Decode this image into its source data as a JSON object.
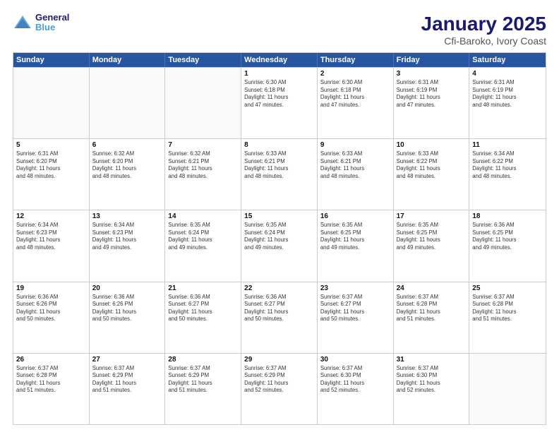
{
  "header": {
    "logo_line1": "General",
    "logo_line2": "Blue",
    "title": "January 2025",
    "subtitle": "Cfi-Baroko, Ivory Coast"
  },
  "days_of_week": [
    "Sunday",
    "Monday",
    "Tuesday",
    "Wednesday",
    "Thursday",
    "Friday",
    "Saturday"
  ],
  "weeks": [
    [
      {
        "num": "",
        "info": "",
        "empty": true
      },
      {
        "num": "",
        "info": "",
        "empty": true
      },
      {
        "num": "",
        "info": "",
        "empty": true
      },
      {
        "num": "1",
        "info": "Sunrise: 6:30 AM\nSunset: 6:18 PM\nDaylight: 11 hours\nand 47 minutes.",
        "empty": false
      },
      {
        "num": "2",
        "info": "Sunrise: 6:30 AM\nSunset: 6:18 PM\nDaylight: 11 hours\nand 47 minutes.",
        "empty": false
      },
      {
        "num": "3",
        "info": "Sunrise: 6:31 AM\nSunset: 6:19 PM\nDaylight: 11 hours\nand 47 minutes.",
        "empty": false
      },
      {
        "num": "4",
        "info": "Sunrise: 6:31 AM\nSunset: 6:19 PM\nDaylight: 11 hours\nand 48 minutes.",
        "empty": false
      }
    ],
    [
      {
        "num": "5",
        "info": "Sunrise: 6:31 AM\nSunset: 6:20 PM\nDaylight: 11 hours\nand 48 minutes.",
        "empty": false
      },
      {
        "num": "6",
        "info": "Sunrise: 6:32 AM\nSunset: 6:20 PM\nDaylight: 11 hours\nand 48 minutes.",
        "empty": false
      },
      {
        "num": "7",
        "info": "Sunrise: 6:32 AM\nSunset: 6:21 PM\nDaylight: 11 hours\nand 48 minutes.",
        "empty": false
      },
      {
        "num": "8",
        "info": "Sunrise: 6:33 AM\nSunset: 6:21 PM\nDaylight: 11 hours\nand 48 minutes.",
        "empty": false
      },
      {
        "num": "9",
        "info": "Sunrise: 6:33 AM\nSunset: 6:21 PM\nDaylight: 11 hours\nand 48 minutes.",
        "empty": false
      },
      {
        "num": "10",
        "info": "Sunrise: 6:33 AM\nSunset: 6:22 PM\nDaylight: 11 hours\nand 48 minutes.",
        "empty": false
      },
      {
        "num": "11",
        "info": "Sunrise: 6:34 AM\nSunset: 6:22 PM\nDaylight: 11 hours\nand 48 minutes.",
        "empty": false
      }
    ],
    [
      {
        "num": "12",
        "info": "Sunrise: 6:34 AM\nSunset: 6:23 PM\nDaylight: 11 hours\nand 48 minutes.",
        "empty": false
      },
      {
        "num": "13",
        "info": "Sunrise: 6:34 AM\nSunset: 6:23 PM\nDaylight: 11 hours\nand 49 minutes.",
        "empty": false
      },
      {
        "num": "14",
        "info": "Sunrise: 6:35 AM\nSunset: 6:24 PM\nDaylight: 11 hours\nand 49 minutes.",
        "empty": false
      },
      {
        "num": "15",
        "info": "Sunrise: 6:35 AM\nSunset: 6:24 PM\nDaylight: 11 hours\nand 49 minutes.",
        "empty": false
      },
      {
        "num": "16",
        "info": "Sunrise: 6:35 AM\nSunset: 6:25 PM\nDaylight: 11 hours\nand 49 minutes.",
        "empty": false
      },
      {
        "num": "17",
        "info": "Sunrise: 6:35 AM\nSunset: 6:25 PM\nDaylight: 11 hours\nand 49 minutes.",
        "empty": false
      },
      {
        "num": "18",
        "info": "Sunrise: 6:36 AM\nSunset: 6:25 PM\nDaylight: 11 hours\nand 49 minutes.",
        "empty": false
      }
    ],
    [
      {
        "num": "19",
        "info": "Sunrise: 6:36 AM\nSunset: 6:26 PM\nDaylight: 11 hours\nand 50 minutes.",
        "empty": false
      },
      {
        "num": "20",
        "info": "Sunrise: 6:36 AM\nSunset: 6:26 PM\nDaylight: 11 hours\nand 50 minutes.",
        "empty": false
      },
      {
        "num": "21",
        "info": "Sunrise: 6:36 AM\nSunset: 6:27 PM\nDaylight: 11 hours\nand 50 minutes.",
        "empty": false
      },
      {
        "num": "22",
        "info": "Sunrise: 6:36 AM\nSunset: 6:27 PM\nDaylight: 11 hours\nand 50 minutes.",
        "empty": false
      },
      {
        "num": "23",
        "info": "Sunrise: 6:37 AM\nSunset: 6:27 PM\nDaylight: 11 hours\nand 50 minutes.",
        "empty": false
      },
      {
        "num": "24",
        "info": "Sunrise: 6:37 AM\nSunset: 6:28 PM\nDaylight: 11 hours\nand 51 minutes.",
        "empty": false
      },
      {
        "num": "25",
        "info": "Sunrise: 6:37 AM\nSunset: 6:28 PM\nDaylight: 11 hours\nand 51 minutes.",
        "empty": false
      }
    ],
    [
      {
        "num": "26",
        "info": "Sunrise: 6:37 AM\nSunset: 6:28 PM\nDaylight: 11 hours\nand 51 minutes.",
        "empty": false
      },
      {
        "num": "27",
        "info": "Sunrise: 6:37 AM\nSunset: 6:29 PM\nDaylight: 11 hours\nand 51 minutes.",
        "empty": false
      },
      {
        "num": "28",
        "info": "Sunrise: 6:37 AM\nSunset: 6:29 PM\nDaylight: 11 hours\nand 51 minutes.",
        "empty": false
      },
      {
        "num": "29",
        "info": "Sunrise: 6:37 AM\nSunset: 6:29 PM\nDaylight: 11 hours\nand 52 minutes.",
        "empty": false
      },
      {
        "num": "30",
        "info": "Sunrise: 6:37 AM\nSunset: 6:30 PM\nDaylight: 11 hours\nand 52 minutes.",
        "empty": false
      },
      {
        "num": "31",
        "info": "Sunrise: 6:37 AM\nSunset: 6:30 PM\nDaylight: 11 hours\nand 52 minutes.",
        "empty": false
      },
      {
        "num": "",
        "info": "",
        "empty": true
      }
    ]
  ]
}
